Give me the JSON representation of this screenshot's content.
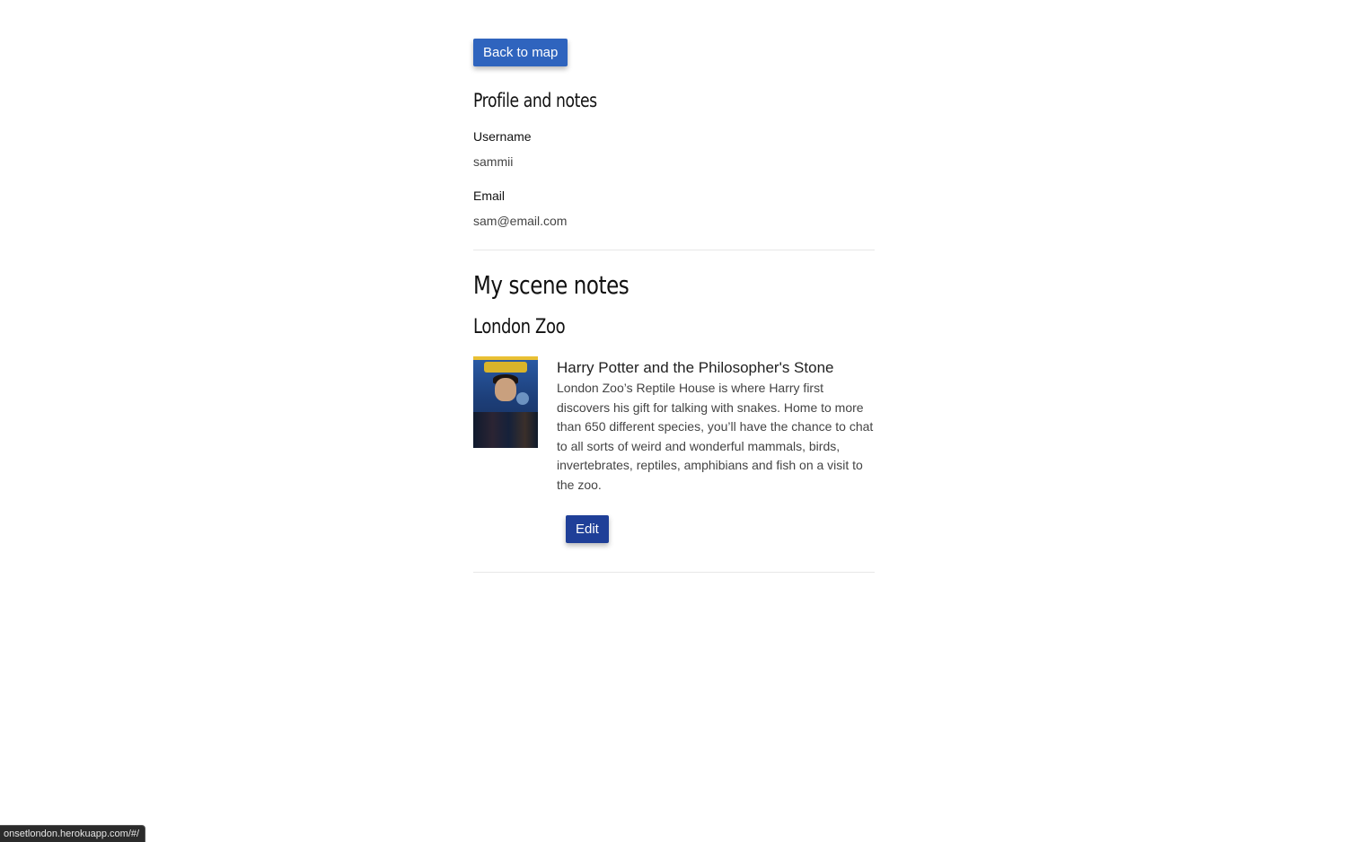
{
  "header": {
    "back_button_label": "Back to map"
  },
  "profile": {
    "heading": "Profile and notes",
    "username_label": "Username",
    "username_value": "sammii",
    "email_label": "Email",
    "email_value": "sam@email.com"
  },
  "notes": {
    "heading": "My scene notes",
    "locations": [
      {
        "name": "London Zoo",
        "items": [
          {
            "poster_icon": "movie-poster-image",
            "title": "Harry Potter and the Philosopher's Stone",
            "text": "London Zoo’s Reptile House is where Harry first discovers his gift for talking with snakes. Home to more than 650 different species, you’ll have the chance to chat to all sorts of weird and wonderful mammals, birds, invertebrates, reptiles, amphibians and fish on a visit to the zoo.",
            "edit_label": "Edit"
          }
        ]
      }
    ]
  },
  "status_bar": {
    "url": "onsetlondon.herokuapp.com/#/"
  },
  "colors": {
    "primary_button": "#2f64be",
    "edit_button": "#1f3f98",
    "divider": "#e8e8e8"
  }
}
